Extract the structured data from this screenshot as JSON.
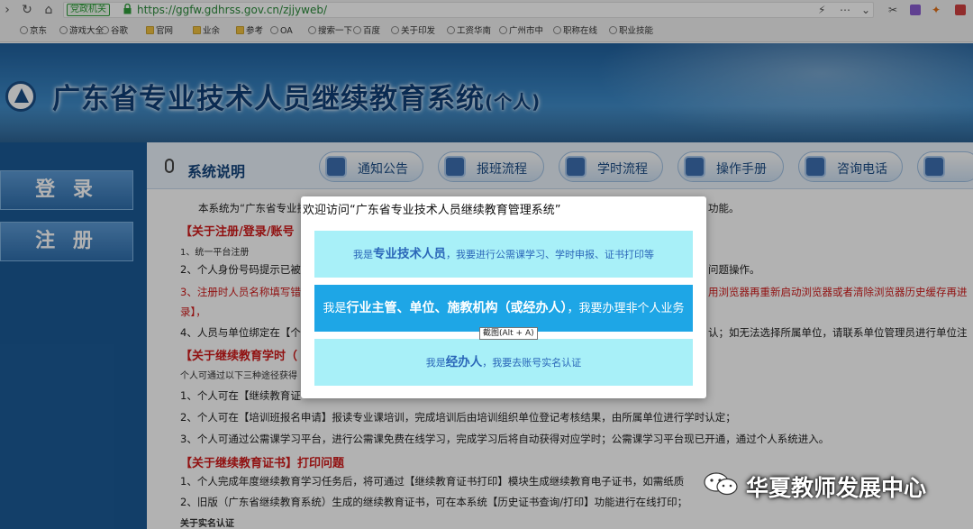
{
  "browser": {
    "badge": "党政机关",
    "url": "https://ggfw.gdhrss.gov.cn/zjjyweb/",
    "bookmarks": [
      "京东",
      "游戏大全",
      "谷歌",
      "官网",
      "业余",
      "参考",
      "OA",
      "搜索一下",
      "百度",
      "关于印发",
      "工资华南",
      "广州市中",
      "职称在线",
      "职业技能"
    ]
  },
  "site": {
    "title": "广东省专业技术人员继续教育系统",
    "title_suffix": "(个人)"
  },
  "sidebar": {
    "login_label": "登 录",
    "register_label": "注 册"
  },
  "section": {
    "title": "系统说明",
    "tabs": [
      "通知公告",
      "报班流程",
      "学时流程",
      "操作手册",
      "咨询电话"
    ]
  },
  "content": {
    "intro": "本系统为“广东省专业技",
    "intro_tail": "功能。",
    "head1": "【关于注册/登录/账号",
    "line1": "1、统一平台注册",
    "line2": "2、个人身份号码提示已被",
    "line2_tail": "问题操作。",
    "line3": "3、注册时人员名称填写错",
    "line3_tail": "用浏览器再重新启动浏览器或者清除浏览器历史缓存再进",
    "line3b": "录】，",
    "line4": "4、人员与单位绑定在【个",
    "line4_tail": "认；如无法选择所属单位，请联系单位管理员进行单位注",
    "head2": "【关于继续教育学时（",
    "line5": "个人可通过以下三种途径获得",
    "line6": "1、个人可在【继续教育证",
    "line7": "2、个人可在【培训班报名申请】报读专业课培训，完成培训后由培训组织单位登记考核结果，由所属单位进行学时认定；",
    "line8": "3、个人可通过公需课学习平台，进行公需课免费在线学习，完成学习后将自动获得对应学时；公需课学习平台现已开通，通过个人系统进入。",
    "head3": "【关于继续教育证书】打印问题",
    "line9": "1、个人完成年度继续教育学习任务后，将可通过【继续教育证书打印】模块生成继续教育电子证书，如需纸质",
    "line10": "2、旧版（广东省继续教育系统）生成的继续教育证书，可在本系统【历史证书查询/打印】功能进行在线打印；",
    "line11": "关于实名认证"
  },
  "modal": {
    "title": "欢迎访问“广东省专业技术人员继续教育管理系统”",
    "options": [
      {
        "prefix": "我是",
        "role": "专业技术人员",
        "desc": "，我要进行公需课学习、学时申报、证书打印等"
      },
      {
        "prefix": "我是",
        "role": "行业主管、单位、施教机构（或经办人）",
        "desc": "，我要办理非个人业务"
      },
      {
        "prefix": "我是",
        "role": "经办人",
        "desc": "，我要去账号实名认证"
      }
    ]
  },
  "tooltip": "截图(Alt + A)",
  "watermark": "华夏教师发展中心",
  "colors": {
    "accent": "#1ea6e6",
    "option_light": "#a8f0f8",
    "heading_red": "#d01a1a",
    "banner_blue": "#2f6eac"
  }
}
